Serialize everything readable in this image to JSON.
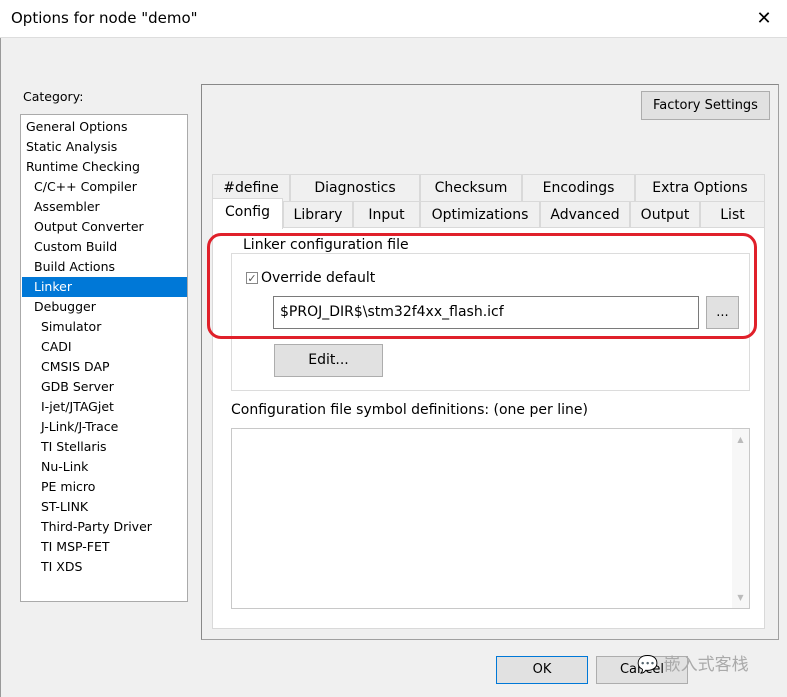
{
  "window": {
    "title": "Options for node \"demo\"",
    "close": "✕"
  },
  "category": {
    "label": "Category:",
    "items": [
      {
        "label": "General Options",
        "indent": 0
      },
      {
        "label": "Static Analysis",
        "indent": 0
      },
      {
        "label": "Runtime Checking",
        "indent": 0
      },
      {
        "label": "C/C++ Compiler",
        "indent": 1
      },
      {
        "label": "Assembler",
        "indent": 1
      },
      {
        "label": "Output Converter",
        "indent": 1
      },
      {
        "label": "Custom Build",
        "indent": 1
      },
      {
        "label": "Build Actions",
        "indent": 1
      },
      {
        "label": "Linker",
        "indent": 1,
        "selected": true
      },
      {
        "label": "Debugger",
        "indent": 1
      },
      {
        "label": "Simulator",
        "indent": 2
      },
      {
        "label": "CADI",
        "indent": 2
      },
      {
        "label": "CMSIS DAP",
        "indent": 2
      },
      {
        "label": "GDB Server",
        "indent": 2
      },
      {
        "label": "I-jet/JTAGjet",
        "indent": 2
      },
      {
        "label": "J-Link/J-Trace",
        "indent": 2
      },
      {
        "label": "TI Stellaris",
        "indent": 2
      },
      {
        "label": "Nu-Link",
        "indent": 2
      },
      {
        "label": "PE micro",
        "indent": 2
      },
      {
        "label": "ST-LINK",
        "indent": 2
      },
      {
        "label": "Third-Party Driver",
        "indent": 2
      },
      {
        "label": "TI MSP-FET",
        "indent": 2
      },
      {
        "label": "TI XDS",
        "indent": 2
      }
    ]
  },
  "factory_settings": "Factory Settings",
  "tabs_row1": [
    "#define",
    "Diagnostics",
    "Checksum",
    "Encodings",
    "Extra Options"
  ],
  "tabs_row2": [
    "Config",
    "Library",
    "Input",
    "Optimizations",
    "Advanced",
    "Output",
    "List"
  ],
  "active_tab": "Config",
  "config": {
    "group_label": "Linker configuration file",
    "override_label": "Override default",
    "override_checked": true,
    "check_glyph": "✓",
    "path": "$PROJ_DIR$\\stm32f4xx_flash.icf",
    "browse": "...",
    "edit": "Edit...",
    "symbols_label": "Configuration file symbol definitions: (one per line)",
    "symbols_value": ""
  },
  "buttons": {
    "ok": "OK",
    "cancel": "Cancel"
  },
  "watermark": "嵌入式客栈",
  "colors": {
    "selection": "#0078d7",
    "highlight": "#e0202a"
  }
}
